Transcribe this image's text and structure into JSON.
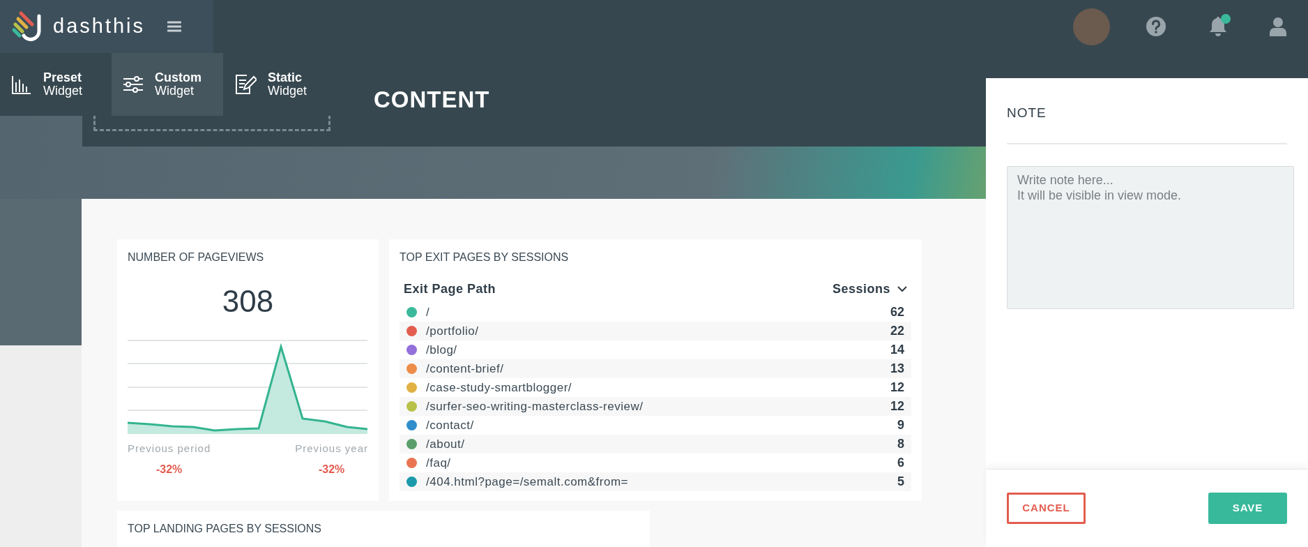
{
  "brand": {
    "name": "dashthis"
  },
  "widget_toolbar": [
    {
      "kind": "preset",
      "title": "Preset",
      "subtitle": "Widget",
      "selected": false
    },
    {
      "kind": "custom",
      "title": "Custom",
      "subtitle": "Widget",
      "selected": true
    },
    {
      "kind": "static",
      "title": "Static",
      "subtitle": "Widget",
      "selected": false
    }
  ],
  "notifications": {
    "unread": true
  },
  "report": {
    "section_title": "CONTENT"
  },
  "pageviews": {
    "title": "NUMBER OF PAGEVIEWS",
    "value": "308",
    "comparisons": [
      {
        "label": "Previous period",
        "change": "-32%"
      },
      {
        "label": "Previous year",
        "change": "-32%"
      }
    ]
  },
  "exit_pages": {
    "title": "TOP EXIT PAGES BY SESSIONS",
    "columns": [
      "Exit Page Path",
      "Sessions"
    ],
    "rows": [
      {
        "path": "/",
        "sessions": "62",
        "color": "#3ab99b"
      },
      {
        "path": "/portfolio/",
        "sessions": "22",
        "color": "#e35d4f"
      },
      {
        "path": "/blog/",
        "sessions": "14",
        "color": "#9370db"
      },
      {
        "path": "/content-brief/",
        "sessions": "13",
        "color": "#ee8c4a"
      },
      {
        "path": "/case-study-smartblogger/",
        "sessions": "12",
        "color": "#e2b144"
      },
      {
        "path": "/surfer-seo-writing-masterclass-review/",
        "sessions": "12",
        "color": "#b8c148"
      },
      {
        "path": "/contact/",
        "sessions": "9",
        "color": "#2f8ecb"
      },
      {
        "path": "/about/",
        "sessions": "8",
        "color": "#5b9e6b"
      },
      {
        "path": "/faq/",
        "sessions": "6",
        "color": "#ea7452"
      },
      {
        "path": "/404.html?page=/semalt.com&from=",
        "sessions": "5",
        "color": "#1b9aaa"
      }
    ]
  },
  "landing_pages": {
    "title": "TOP LANDING PAGES BY SESSIONS"
  },
  "note_panel": {
    "title": "NOTE",
    "placeholder": "Write note here...\nIt will be visible in view mode.",
    "buttons": [
      {
        "kind": "cancel",
        "label": "CANCEL"
      },
      {
        "kind": "save",
        "label": "SAVE"
      }
    ]
  }
}
